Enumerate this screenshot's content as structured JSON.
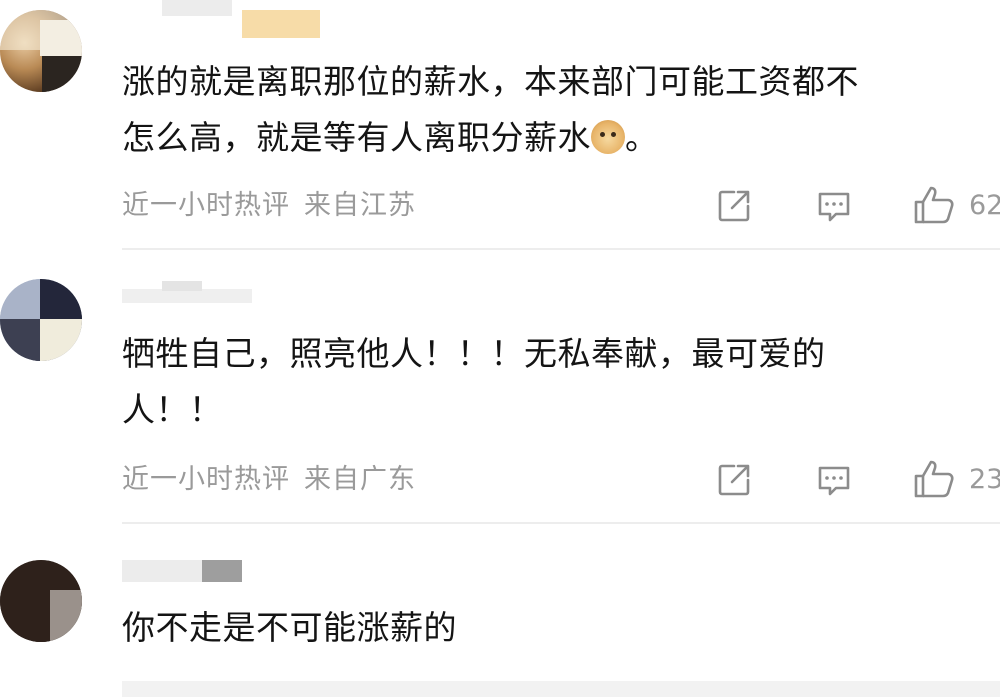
{
  "comments": [
    {
      "text_line1": "涨的就是离职那位的薪水，本来部门可能工资都不",
      "text_line2": "怎么高，就是等有人离职分薪水",
      "text_tail": "。",
      "emoji": "doge-emoji",
      "time": "近一小时热评",
      "location": "来自江苏",
      "likes": "62"
    },
    {
      "text_line1": "牺牲自己，照亮他人！！！无私奉献，最可爱的",
      "text_line2": "人！！",
      "time": "近一小时热评",
      "location": "来自广东",
      "likes": "23"
    },
    {
      "text_line1": "你不走是不可能涨薪的"
    }
  ],
  "icons": {
    "share": "share-icon",
    "reply": "comment-icon",
    "like": "thumbs-up-icon"
  },
  "colors": {
    "text": "#141414",
    "meta": "#9a9a9a",
    "icon": "#8c8c8c",
    "divider": "#ededed"
  }
}
